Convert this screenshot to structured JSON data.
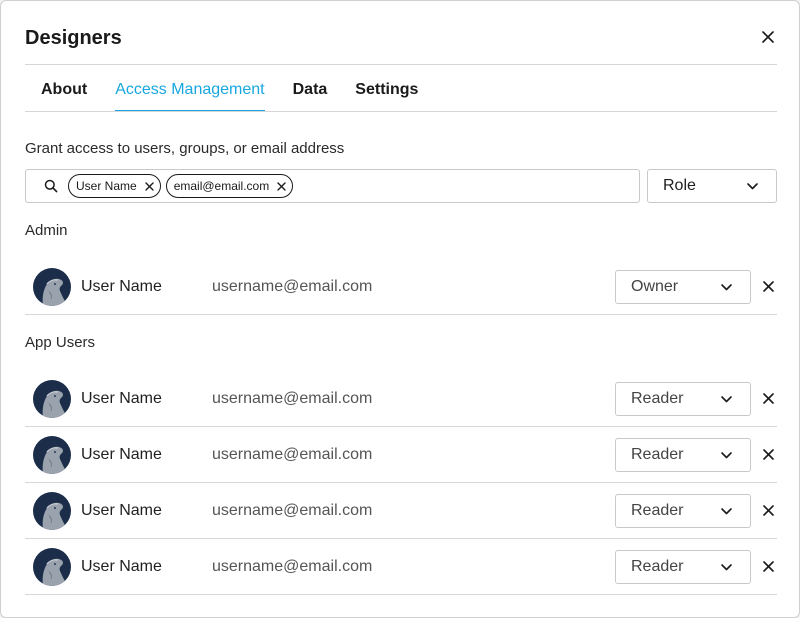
{
  "dialog": {
    "title": "Designers"
  },
  "tabs": [
    {
      "label": "About",
      "active": false
    },
    {
      "label": "Access Management",
      "active": true
    },
    {
      "label": "Data",
      "active": false
    },
    {
      "label": "Settings",
      "active": false
    }
  ],
  "grant": {
    "label": "Grant access to users, groups, or email address",
    "chips": [
      "User Name",
      "email@email.com"
    ],
    "role_select": "Role"
  },
  "sections": {
    "admin_label": "Admin",
    "app_users_label": "App Users"
  },
  "admin_users": [
    {
      "name": "User Name",
      "email": "username@email.com",
      "role": "Owner"
    }
  ],
  "app_users": [
    {
      "name": "User Name",
      "email": "username@email.com",
      "role": "Reader"
    },
    {
      "name": "User Name",
      "email": "username@email.com",
      "role": "Reader"
    },
    {
      "name": "User Name",
      "email": "username@email.com",
      "role": "Reader"
    },
    {
      "name": "User Name",
      "email": "username@email.com",
      "role": "Reader"
    }
  ],
  "colors": {
    "accent": "#18a7df",
    "avatar_bg": "#1c2d4a",
    "divider": "#d6d6d6"
  }
}
